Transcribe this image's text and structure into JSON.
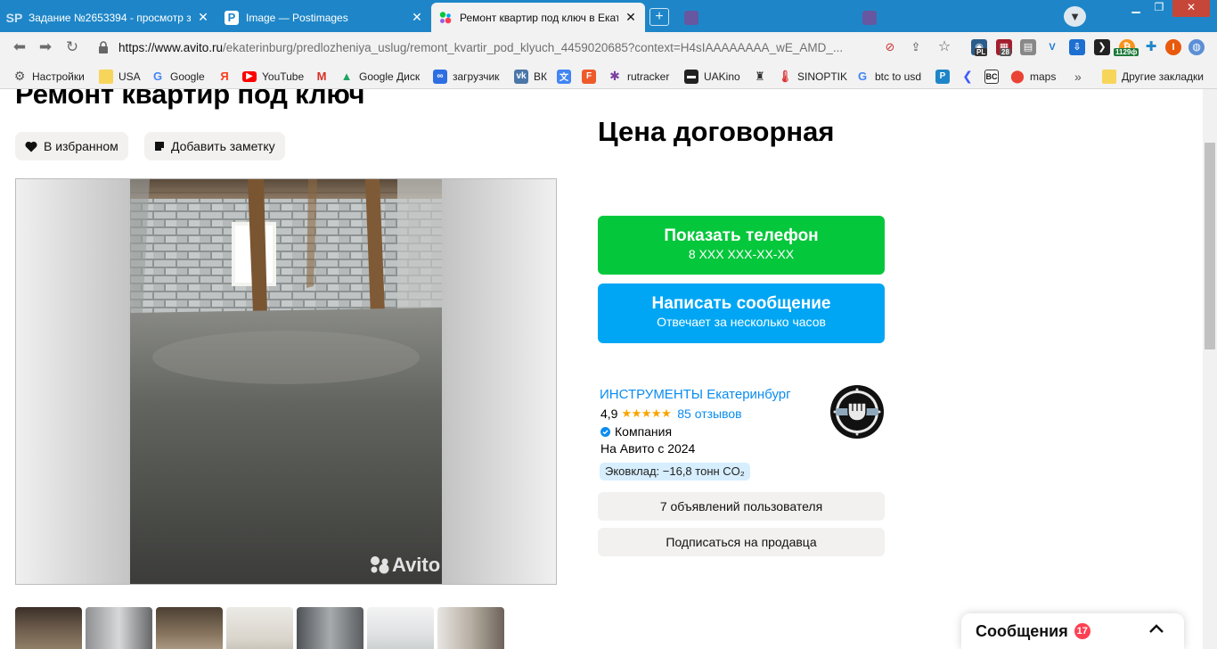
{
  "browser": {
    "tabs": [
      {
        "icon": "sp-icon",
        "icon_text": "SP",
        "title": "Задание №2653394 - просмотр з"
      },
      {
        "icon": "postimages-icon",
        "icon_text": "P",
        "title": "Image — Postimages"
      },
      {
        "icon": "avito-icon",
        "icon_text": "",
        "title": "Ремонт квартир под ключ в Екате"
      }
    ],
    "new_tab_label": "+",
    "profile_icon": "tshirt-icon",
    "window_controls": [
      "minimize",
      "maximize",
      "close"
    ],
    "url_host": "https://www.avito.ru",
    "url_rest": "/ekaterinburg/predlozheniya_uslug/remont_kvartir_pod_klyuch_4459020685?context=H4sIAAAAAAAA_wE_AMD_...",
    "extensions": [
      {
        "name": "pl-extension-icon",
        "badge": "PL"
      },
      {
        "name": "calendar-extension-icon",
        "badge": "28"
      },
      {
        "name": "briefcase-extension-icon",
        "badge": ""
      },
      {
        "name": "v-extension-icon",
        "badge": ""
      },
      {
        "name": "download-extension-icon",
        "badge": ""
      },
      {
        "name": "terminal-extension-icon",
        "badge": ""
      },
      {
        "name": "coin-extension-icon",
        "badge": "1129ф"
      },
      {
        "name": "puzzle-icon",
        "badge": ""
      },
      {
        "name": "profile-avatar-icon",
        "badge": "I"
      },
      {
        "name": "globe-extension-icon",
        "badge": ""
      }
    ]
  },
  "bookmarks": [
    {
      "label": "Настройки",
      "icon": "gear-icon"
    },
    {
      "label": "USA",
      "icon": "folder-icon"
    },
    {
      "label": "Google",
      "icon": "google-icon"
    },
    {
      "label": "",
      "icon": "yandex-icon"
    },
    {
      "label": "YouTube",
      "icon": "youtube-icon"
    },
    {
      "label": "",
      "icon": "gmail-icon"
    },
    {
      "label": "Google Диск",
      "icon": "google-drive-icon"
    },
    {
      "label": "загрузчик",
      "icon": "infinity-icon"
    },
    {
      "label": "ВК",
      "icon": "vk-icon"
    },
    {
      "label": "",
      "icon": "translate-icon"
    },
    {
      "label": "",
      "icon": "f-bookmark-icon"
    },
    {
      "label": "rutracker",
      "icon": "rutracker-icon"
    },
    {
      "label": "UAKino",
      "icon": "film-icon"
    },
    {
      "label": "",
      "icon": "bottle-icon"
    },
    {
      "label": "SINOPTIK",
      "icon": "thermometer-icon"
    },
    {
      "label": "btc to usd",
      "icon": "google-icon"
    },
    {
      "label": "",
      "icon": "p-bookmark-icon"
    },
    {
      "label": "",
      "icon": "arrow-bookmark-icon"
    },
    {
      "label": "",
      "icon": "bc-bookmark-icon"
    },
    {
      "label": "maps",
      "icon": "maps-pin-icon"
    },
    {
      "label": "»",
      "icon": "more-bookmarks-icon"
    },
    {
      "label": "Другие закладки",
      "icon": "folder-icon"
    }
  ],
  "listing": {
    "title": "Ремонт квартир под ключ",
    "favorite_label": "В избранном",
    "note_label": "Добавить заметку",
    "watermark": "Avito",
    "thumbnail_count": 7
  },
  "contact": {
    "price": "Цена договорная",
    "phone_button": {
      "label": "Показать телефон",
      "sub": "8 XXX XXX-XX-XX"
    },
    "message_button": {
      "label": "Написать сообщение",
      "sub": "Отвечает за несколько часов"
    }
  },
  "seller": {
    "name": "ИНСТРУМЕНТЫ Екатеринбург",
    "rating": "4,9",
    "stars": "★★★★★",
    "reviews": "85 отзывов",
    "type": "Компания",
    "since": "На Авито с 2024",
    "eco": "Эковклад: −16,8 тонн CO₂",
    "listings_button": "7 объявлений пользователя",
    "subscribe_button": "Подписаться на продавца"
  },
  "messenger": {
    "title": "Сообщения",
    "badge": "17"
  },
  "colors": {
    "phone_green": "#04c73b",
    "message_blue": "#00a6f4",
    "link_blue": "#0a8cf0",
    "star_orange": "#f9a400",
    "badge_red": "#ff4053",
    "tabstrip_blue": "#1e86c8"
  }
}
